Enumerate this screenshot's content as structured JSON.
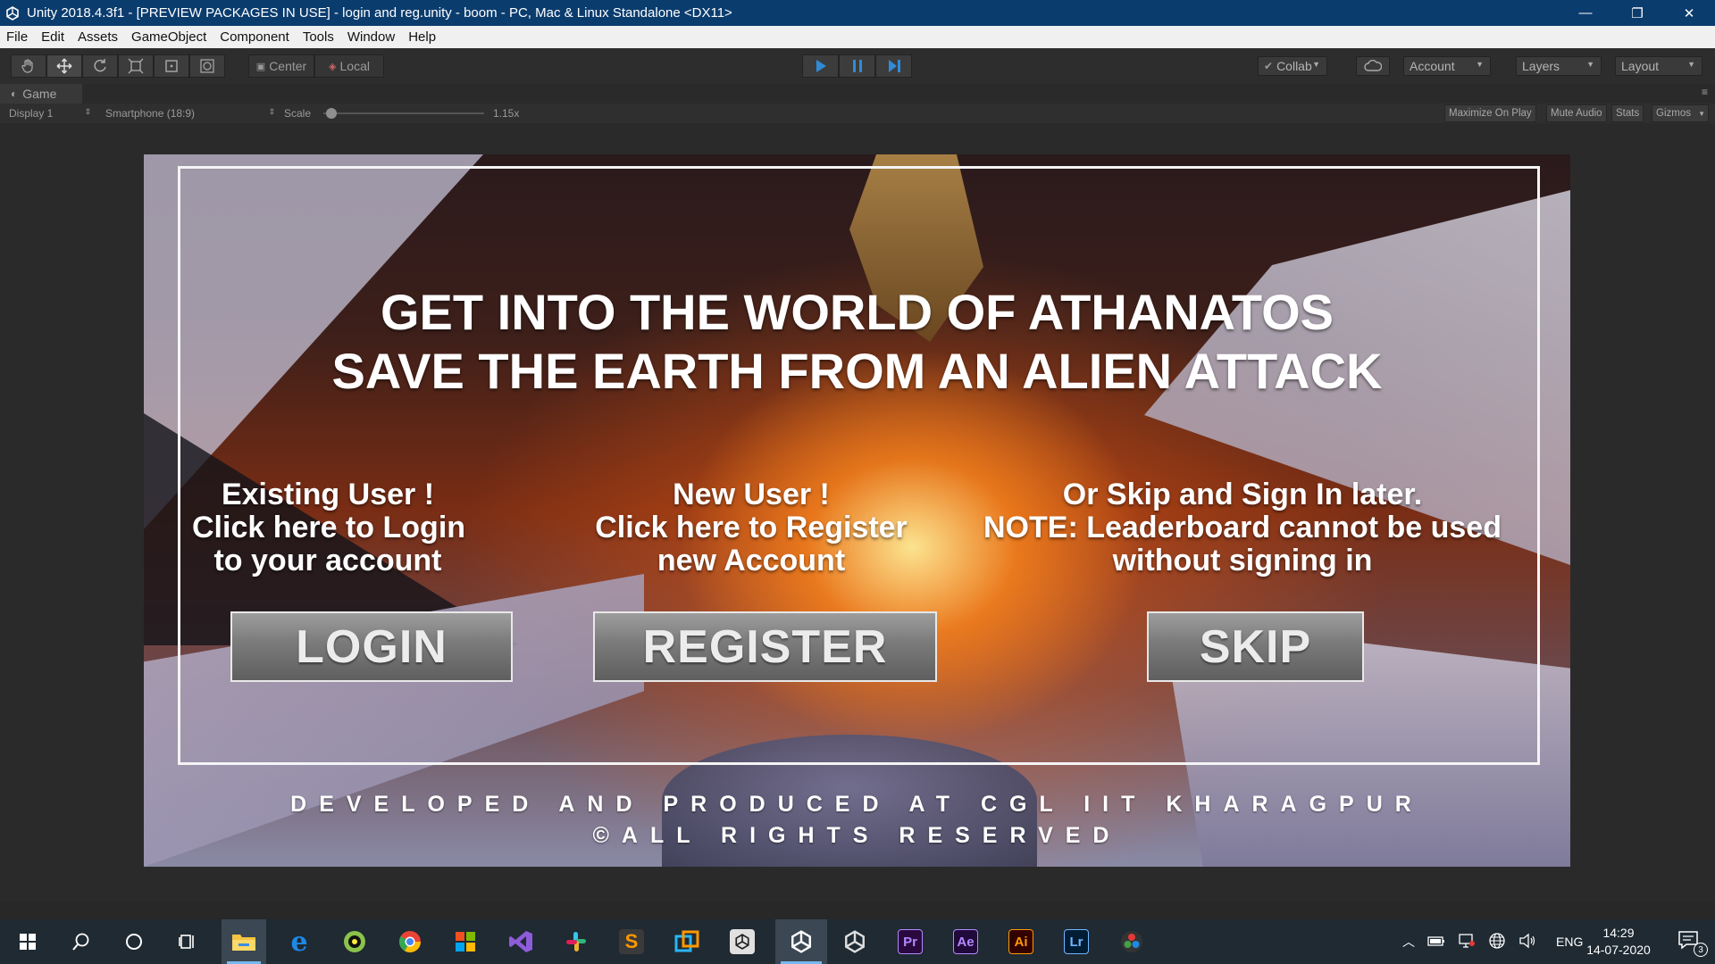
{
  "window": {
    "title": "Unity 2018.4.3f1 - [PREVIEW PACKAGES IN USE] - login and reg.unity - boom - PC, Mac & Linux Standalone <DX11>",
    "minimize": "—",
    "restore": "❐",
    "close": "✕"
  },
  "menu": [
    "File",
    "Edit",
    "Assets",
    "GameObject",
    "Component",
    "Tools",
    "Window",
    "Help"
  ],
  "toolbar": {
    "pivot_label": "Center",
    "space_label": "Local",
    "collab_label": "Collab",
    "account_label": "Account",
    "layers_label": "Layers",
    "layout_label": "Layout"
  },
  "game_tab": {
    "tab_label": "Game",
    "display_label": "Display 1",
    "resolution_label": "Smartphone (18:9)",
    "scale_label": "Scale",
    "scale_value": "1.15x",
    "scale_fraction": 0.05,
    "maximize_label": "Maximize On Play",
    "mute_label": "Mute Audio",
    "stats_label": "Stats",
    "gizmos_label": "Gizmos"
  },
  "game": {
    "headline_line1": "GET INTO THE WORLD OF ATHANATOS",
    "headline_line2": "SAVE THE EARTH FROM AN ALIEN ATTACK",
    "existing_line1": "Existing User !",
    "existing_line2": "Click here to Login",
    "existing_line3": "to your account",
    "new_line1": "New User !",
    "new_line2": "Click here to Register",
    "new_line3": "new Account",
    "skip_line1": "Or Skip and Sign In later.",
    "skip_line2": "NOTE: Leaderboard cannot be used",
    "skip_line3": "without signing in",
    "login_button": "LOGIN",
    "register_button": "REGISTER",
    "skip_button": "SKIP",
    "credit_line1": "DEVELOPED AND PRODUCED AT CGL IIT KHARAGPUR",
    "credit_line2": "©ALL RIGHTS RESERVED"
  },
  "taskbar": {
    "apps": [
      {
        "name": "windows-start-icon",
        "color": "#ffffff"
      },
      {
        "name": "search-icon",
        "color": "#ffffff"
      },
      {
        "name": "cortana-icon",
        "color": "#ffffff"
      },
      {
        "name": "task-view-icon",
        "color": "#ffffff"
      },
      {
        "name": "file-explorer-icon",
        "color": "#f6c343"
      },
      {
        "name": "edge-icon",
        "color": "#1e88e5"
      },
      {
        "name": "app-globe-icon",
        "color": "#8bc34a"
      },
      {
        "name": "chrome-icon",
        "color": "#ea4335"
      },
      {
        "name": "microsoft-store-icon",
        "color": "#7cb342"
      },
      {
        "name": "visual-studio-icon",
        "color": "#8e5cd9"
      },
      {
        "name": "slack-icon",
        "color": "#e01e5a"
      },
      {
        "name": "sublime-text-icon",
        "color": "#ff9800"
      },
      {
        "name": "app-windows-icon",
        "color": "#29b6f6"
      },
      {
        "name": "unity-hub-icon",
        "color": "#dddddd"
      },
      {
        "name": "unity-icon",
        "color": "#ffffff"
      },
      {
        "name": "unity-editor-icon",
        "color": "#dddddd"
      },
      {
        "name": "premiere-pro-icon",
        "color": "#b388ff",
        "label": "Pr"
      },
      {
        "name": "after-effects-icon",
        "color": "#b388ff",
        "label": "Ae"
      },
      {
        "name": "illustrator-icon",
        "color": "#ff9a00",
        "label": "Ai"
      },
      {
        "name": "lightroom-icon",
        "color": "#74b5ff",
        "label": "Lr"
      },
      {
        "name": "davinci-resolve-icon",
        "color": "#e0e0e0"
      }
    ],
    "language": "ENG",
    "time": "14:29",
    "date": "14-07-2020",
    "notification_count": "3"
  }
}
